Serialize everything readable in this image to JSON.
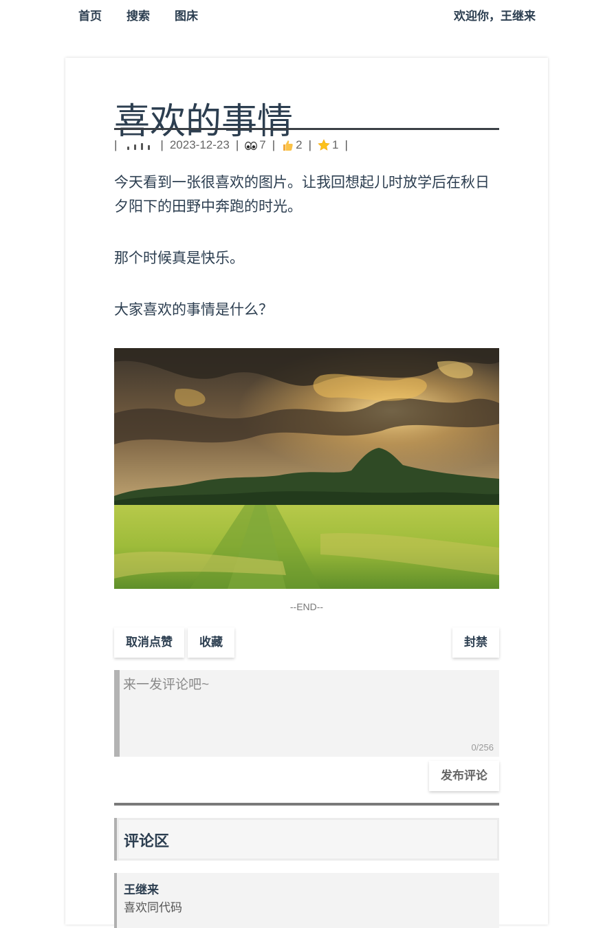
{
  "nav": {
    "home": "首页",
    "search": "搜索",
    "gallery": "图床",
    "welcome": "欢迎你，王继来"
  },
  "post": {
    "title": "喜欢的事情",
    "date": "2023-12-23",
    "views": "7",
    "likes": "2",
    "favorites": "1",
    "paragraphs": [
      "今天看到一张很喜欢的图片。让我回想起儿时放学后在秋日夕阳下的田野中奔跑的时光。",
      "那个时候真是快乐。",
      "大家喜欢的事情是什么？"
    ],
    "end_marker": "--END--"
  },
  "actions": {
    "unlike": "取消点赞",
    "favorite": "收藏",
    "ban": "封禁"
  },
  "comment_form": {
    "placeholder": "来一发评论吧~",
    "counter": "0/256",
    "submit": "发布评论"
  },
  "comments": {
    "heading": "评论区",
    "items": [
      {
        "user": "王继来",
        "text": "喜欢同代码"
      }
    ]
  },
  "icons": [
    "eyes-icon",
    "thumbs-up-icon",
    "star-icon"
  ]
}
